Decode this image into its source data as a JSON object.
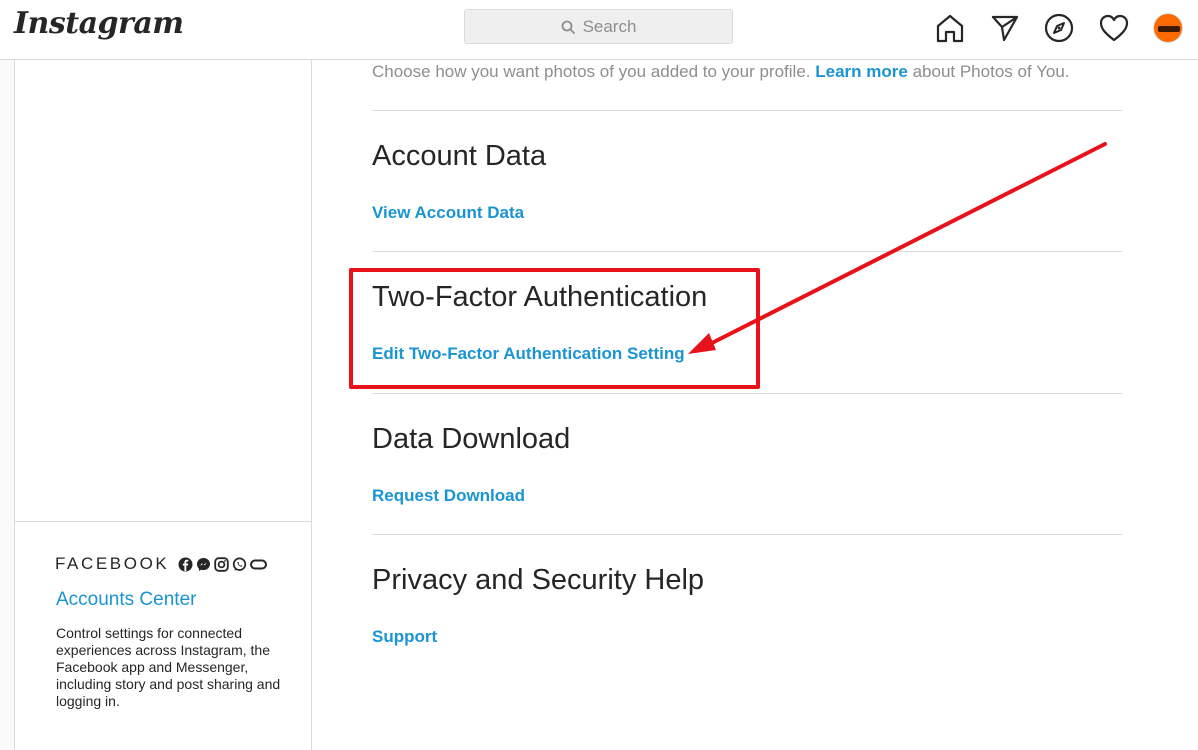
{
  "header": {
    "logo": "Instagram",
    "search_placeholder": "Search",
    "icons": [
      "home-icon",
      "direct-messages-icon",
      "explore-icon",
      "activity-heart-icon",
      "profile-avatar"
    ]
  },
  "sidebar": {
    "brand": "FACEBOOK",
    "brand_icons": [
      "facebook-icon",
      "messenger-icon",
      "instagram-icon",
      "whatsapp-icon",
      "oculus-icon"
    ],
    "accounts_center_label": "Accounts Center",
    "accounts_center_desc": "Control settings for connected experiences across Instagram, the Facebook app and Messenger, including story and post sharing and logging in."
  },
  "main": {
    "intro_text": "Choose how you want photos of you added to your profile.",
    "intro_link": "Learn more",
    "intro_suffix": "about Photos of You.",
    "sections": [
      {
        "title": "Account Data",
        "link": "View Account Data"
      },
      {
        "title": "Two-Factor Authentication",
        "link": "Edit Two-Factor Authentication Setting"
      },
      {
        "title": "Data Download",
        "link": "Request Download"
      },
      {
        "title": "Privacy and Security Help",
        "link": "Support"
      }
    ]
  },
  "annotation": {
    "color": "#e8121a",
    "target": "Two-Factor Authentication"
  },
  "colors": {
    "link": "#1a94d2",
    "text": "#262626",
    "muted": "#8e8e8e",
    "border": "#dbdbdb"
  }
}
